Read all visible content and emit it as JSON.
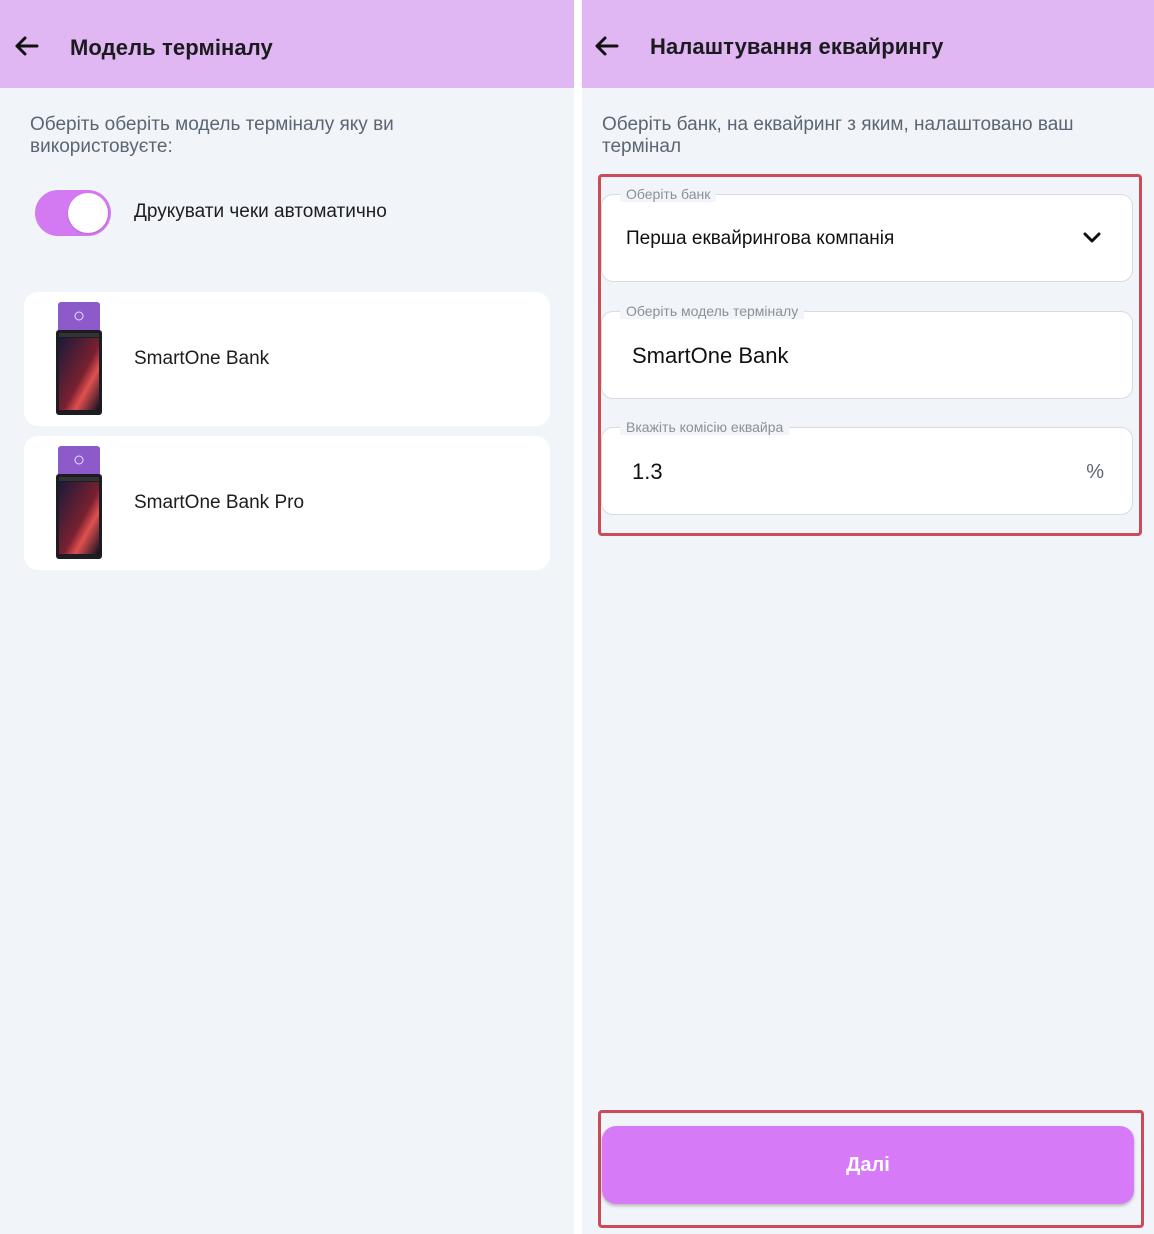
{
  "left_screen": {
    "title": "Модель терміналу",
    "hint": "Оберіть оберіть модель терміналу яку ви використовуєте:",
    "auto_print": {
      "label": "Друкувати чеки автоматично",
      "enabled": true
    },
    "terminals": [
      {
        "name": "SmartOne Bank"
      },
      {
        "name": "SmartOne Bank Pro"
      }
    ]
  },
  "right_screen": {
    "title": "Налаштування еквайрингу",
    "hint": "Оберіть банк, на еквайринг з яким, налаштовано ваш термінал",
    "bank_select": {
      "label": "Оберіть банк",
      "value": "Перша еквайрингова компанія"
    },
    "terminal_model": {
      "label": "Оберіть модель терміналу",
      "value": "SmartOne Bank"
    },
    "commission": {
      "label": "Вкажіть комісію еквайра",
      "value": "1.3",
      "suffix": "%"
    },
    "next_button": "Далі"
  },
  "icons": [
    "arrow-back-icon",
    "chevron-down-icon"
  ],
  "colors": {
    "appbar": "#e0b6f3",
    "accent": "#d67af7",
    "background": "#f1f4f8",
    "highlight_border": "#cc4b58"
  }
}
